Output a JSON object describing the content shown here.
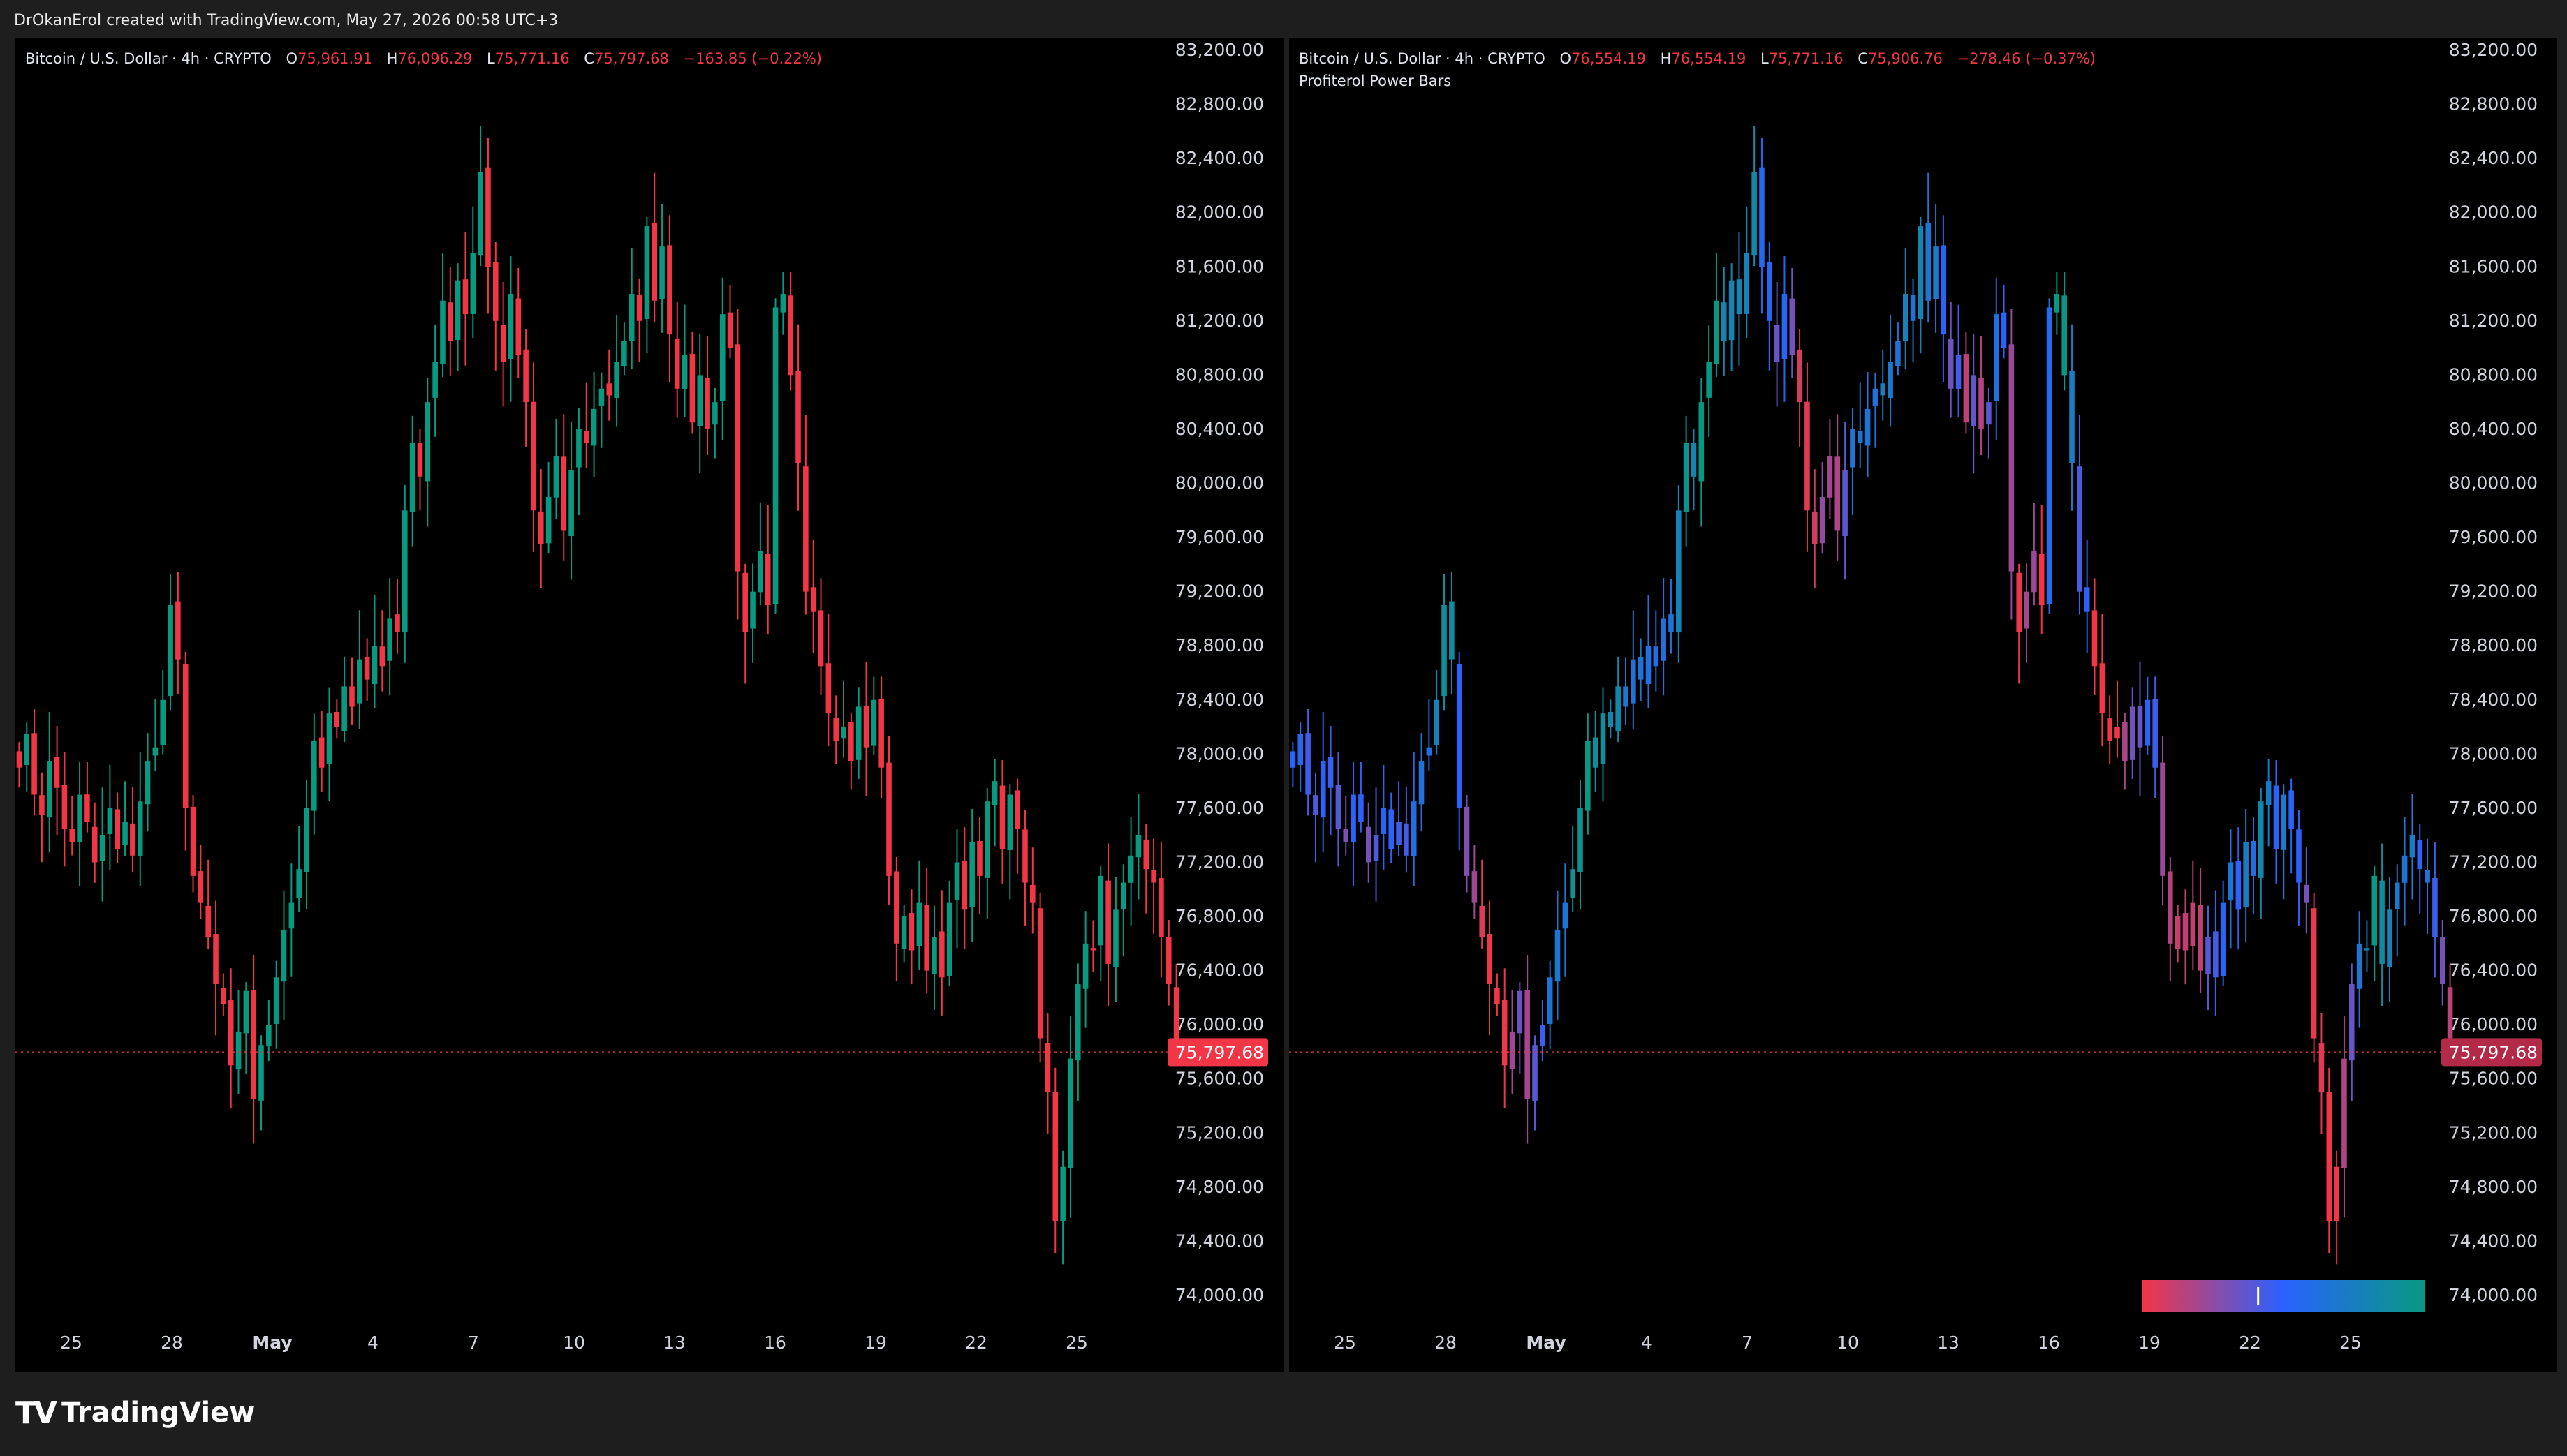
{
  "header": {
    "credit": "DrOkanErol created with TradingView.com, May 27, 2026 00:58 UTC+3"
  },
  "branding": {
    "logo_text": "TradingView",
    "logo_mark": "TV"
  },
  "colors": {
    "up": "#089981",
    "down": "#f23645",
    "power_low": "#f23645",
    "power_mid": "#2962ff",
    "power_high": "#089981",
    "background": "#000000",
    "frame": "#1e1e1e",
    "axis_text": "#d1d4dc",
    "last_price_bg_left": "#f23645",
    "last_price_bg_right": "#b22a48"
  },
  "left_chart": {
    "symbol": "Bitcoin / U.S. Dollar · 4h · CRYPTO",
    "o_label": "O",
    "o_value": "75,961.91",
    "h_label": "H",
    "h_value": "76,096.29",
    "l_label": "L",
    "l_value": "75,771.16",
    "c_label": "C",
    "c_value": "75,797.68",
    "change": "−163.85 (−0.22%)"
  },
  "right_chart": {
    "symbol": "Bitcoin / U.S. Dollar · 4h · CRYPTO",
    "o_label": "O",
    "o_value": "76,554.19",
    "h_label": "H",
    "h_value": "76,554.19",
    "l_label": "L",
    "l_value": "75,771.16",
    "c_label": "C",
    "c_value": "75,906.76",
    "change": "−278.46 (−0.37%)",
    "indicator": "Profiterol Power Bars"
  },
  "chart_data": [
    {
      "type": "candlestick",
      "title": "Bitcoin / U.S. Dollar · 4h · CRYPTO",
      "ylim": [
        74000,
        83200
      ],
      "y_ticks": [
        "83,200.00",
        "82,800.00",
        "82,400.00",
        "82,000.00",
        "81,600.00",
        "81,200.00",
        "80,800.00",
        "80,400.00",
        "80,000.00",
        "79,600.00",
        "79,200.00",
        "78,800.00",
        "78,400.00",
        "78,000.00",
        "77,600.00",
        "77,200.00",
        "76,800.00",
        "76,400.00",
        "76,000.00",
        "75,600.00",
        "75,200.00",
        "74,800.00",
        "74,400.00",
        "74,000.00"
      ],
      "x_ticks": [
        "25",
        "28",
        "May",
        "4",
        "7",
        "10",
        "13",
        "16",
        "19",
        "22",
        "25"
      ],
      "last_price": "75,797.68",
      "last_price_value": 75797.68,
      "grid": false,
      "coloring": "up-down",
      "closes": [
        77900,
        78150,
        77700,
        77550,
        77950,
        77750,
        77450,
        77350,
        77700,
        77500,
        77200,
        77400,
        77600,
        77300,
        77500,
        77250,
        77650,
        77950,
        78050,
        78400,
        79100,
        78700,
        77600,
        77100,
        76900,
        76650,
        76300,
        76150,
        75700,
        75950,
        76250,
        75450,
        75850,
        76000,
        76350,
        76700,
        76900,
        77150,
        77600,
        78100,
        77900,
        78300,
        78200,
        78500,
        78350,
        78700,
        78550,
        78800,
        78650,
        79000,
        78900,
        79800,
        80300,
        80050,
        80600,
        80900,
        81350,
        81050,
        81500,
        81250,
        81700,
        82300,
        81600,
        81200,
        80900,
        81400,
        80950,
        80600,
        79800,
        79550,
        79900,
        80200,
        79650,
        80100,
        80400,
        80300,
        80550,
        80700,
        80650,
        80900,
        81050,
        81400,
        81200,
        81900,
        81350,
        81750,
        81100,
        80700,
        80950,
        80450,
        80800,
        80400,
        80600,
        81250,
        81000,
        79350,
        78900,
        79200,
        79500,
        79100,
        81300,
        81400,
        80800,
        80150,
        79200,
        79050,
        78650,
        78300,
        78100,
        78200,
        77950,
        78350,
        78050,
        78400,
        77900,
        77100,
        76600,
        76800,
        76550,
        76900,
        76400,
        76650,
        76350,
        76900,
        77200,
        76850,
        77350,
        77100,
        77650,
        77800,
        77300,
        77700,
        77450,
        77050,
        76900,
        75900,
        75500,
        74550,
        74950,
        75750,
        76300,
        76600,
        76550,
        77100,
        76450,
        76850,
        77050,
        77250,
        77400,
        77150,
        77050,
        76650,
        76300,
        75797.68
      ]
    },
    {
      "type": "candlestick",
      "title": "Bitcoin / U.S. Dollar · 4h · CRYPTO",
      "indicator": "Profiterol Power Bars",
      "ylim": [
        74000,
        83200
      ],
      "y_ticks": [
        "83,200.00",
        "82,800.00",
        "82,400.00",
        "82,000.00",
        "81,600.00",
        "81,200.00",
        "80,800.00",
        "80,400.00",
        "80,000.00",
        "79,600.00",
        "79,200.00",
        "78,800.00",
        "78,400.00",
        "78,000.00",
        "77,600.00",
        "77,200.00",
        "76,800.00",
        "76,400.00",
        "76,000.00",
        "75,600.00",
        "75,200.00",
        "74,800.00",
        "74,400.00",
        "74,000.00"
      ],
      "x_ticks": [
        "25",
        "28",
        "May",
        "4",
        "7",
        "10",
        "13",
        "16",
        "19",
        "22",
        "25"
      ],
      "last_price": "75,797.68",
      "last_price_value": 75797.68,
      "grid": false,
      "coloring": "power-gradient",
      "gradient_legend": {
        "colors": [
          "#f23645",
          "#2962ff",
          "#089981"
        ],
        "marker": 0.41
      }
    }
  ]
}
